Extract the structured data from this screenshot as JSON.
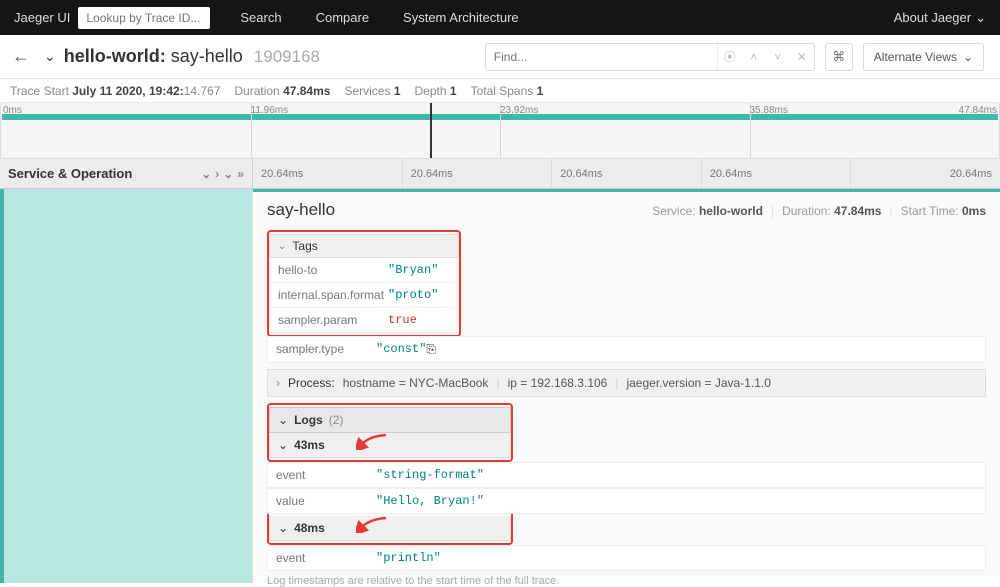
{
  "nav": {
    "brand": "Jaeger UI",
    "placeholder": "Lookup by Trace ID...",
    "search": "Search",
    "compare": "Compare",
    "arch": "System Architecture",
    "about": "About Jaeger"
  },
  "header": {
    "svc": "hello-world:",
    "op": " say-hello",
    "id": "1909168",
    "find_ph": "Find...",
    "alt": "Alternate Views"
  },
  "meta": {
    "ts_l": "Trace Start",
    "ts_b": "July 11 2020, 19:42:",
    "ts_t": "14.767",
    "dur_l": "Duration",
    "dur": "47.84ms",
    "svc_l": "Services",
    "svc": "1",
    "dep_l": "Depth",
    "dep": "1",
    "tot_l": "Total Spans",
    "tot": "1"
  },
  "ticks": {
    "t0": "0ms",
    "t1": "11.96ms",
    "t2": "23.92ms",
    "t3": "35.88ms",
    "t4": "47.84ms"
  },
  "so": {
    "label": "Service & Operation",
    "cell": "20.64ms"
  },
  "span": {
    "name": "say-hello",
    "svc_l": "Service:",
    "svc": "hello-world",
    "dur_l": "Duration:",
    "dur": "47.84ms",
    "st_l": "Start Time:",
    "st": "0ms"
  },
  "tags": {
    "title": "Tags",
    "rows": [
      {
        "k": "hello-to",
        "v": "\"Bryan\"",
        "cls": "vs"
      },
      {
        "k": "internal.span.format",
        "v": "\"proto\"",
        "cls": "vs"
      },
      {
        "k": "sampler.param",
        "v": "true",
        "cls": "vb"
      },
      {
        "k": "sampler.type",
        "v": "\"const\"",
        "cls": "vs"
      }
    ]
  },
  "proc": {
    "title": "Process:",
    "h_k": "hostname",
    "h_v": "NYC-MacBook",
    "i_k": "ip",
    "i_v": "192.168.3.106",
    "j_k": "jaeger.version",
    "j_v": "Java-1.1.0"
  },
  "logs": {
    "title": "Logs",
    "count": "(2)",
    "e1": {
      "t": "43ms",
      "r": [
        {
          "k": "event",
          "v": "\"string-format\""
        },
        {
          "k": "value",
          "v": "\"Hello, Bryan!\""
        }
      ]
    },
    "e2": {
      "t": "48ms",
      "r": [
        {
          "k": "event",
          "v": "\"println\""
        }
      ]
    },
    "note": "Log timestamps are relative to the start time of the full trace."
  }
}
